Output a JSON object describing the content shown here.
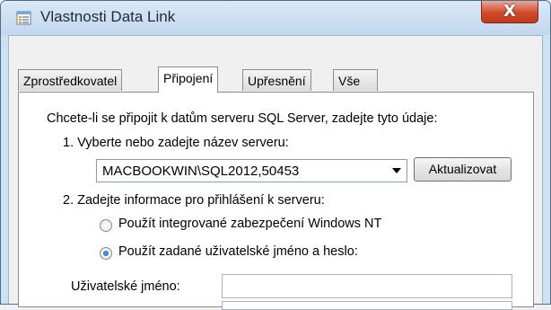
{
  "window": {
    "title": "Vlastnosti Data Link",
    "close_symbol": "X"
  },
  "tabs": [
    {
      "label": "Zprostředkovatel",
      "active": false
    },
    {
      "label": "Připojení",
      "active": true
    },
    {
      "label": "Upřesnění",
      "active": false
    },
    {
      "label": "Vše",
      "active": false
    }
  ],
  "connection": {
    "intro": "Chcete-li se připojit k datům serveru SQL Server, zadejte tyto údaje:",
    "step1_label": "1. Vyberte nebo zadejte název serveru:",
    "server_value": "MACBOOKWIN\\SQL2012,50453",
    "refresh_button": "Aktualizovat",
    "step2_label": "2. Zadejte informace pro přihlášení k serveru:",
    "auth_options": [
      {
        "label": "Použít integrované zabezpečení Windows NT",
        "selected": false
      },
      {
        "label": "Použít zadané uživatelské jméno a heslo:",
        "selected": true
      }
    ],
    "username_label": "Uživatelské jméno:",
    "username_value": ""
  },
  "icons": {
    "app": "data-link-properties-icon",
    "close": "close-icon",
    "dropdown": "chevron-down-icon"
  }
}
